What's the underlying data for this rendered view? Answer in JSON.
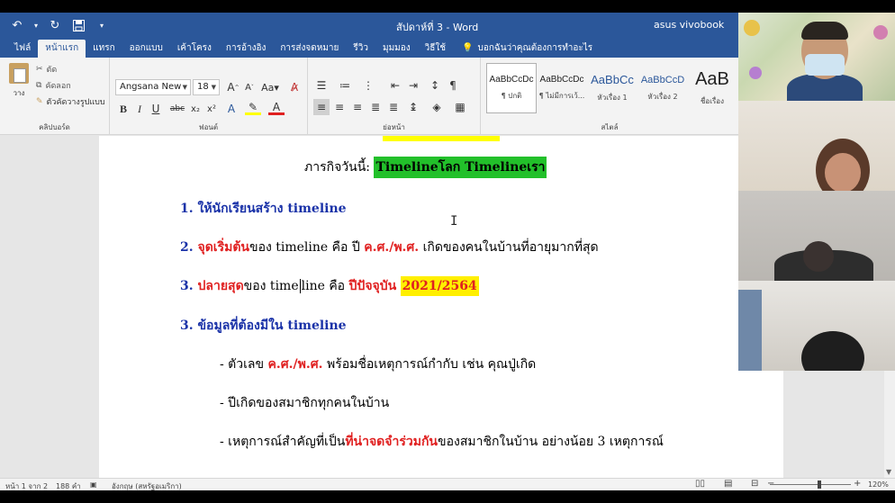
{
  "app": {
    "doc_title": "สัปดาห์ที่ 3  -  Word",
    "account": "asus vivobook"
  },
  "tabs": [
    "ไฟล์",
    "หน้าแรก",
    "แทรก",
    "ออกแบบ",
    "เค้าโครง",
    "การอ้างอิง",
    "การส่งจดหมาย",
    "รีวิว",
    "มุมมอง",
    "วิธีใช้"
  ],
  "active_tab": "หน้าแรก",
  "tell_me": "บอกฉันว่าคุณต้องการทำอะไร",
  "clipboard": {
    "paste": "วาง",
    "cut": "ตัด",
    "copy": "คัดลอก",
    "format_painter": "ตัวคัดวางรูปแบบ",
    "label": "คลิปบอร์ด"
  },
  "font": {
    "name": "Angsana New",
    "size": "18",
    "label": "ฟอนต์",
    "grow": "A",
    "aa": "Aa"
  },
  "paragraph": {
    "label": "ย่อหน้า"
  },
  "styles": {
    "label": "สไตล์",
    "items": [
      {
        "sample": "AaBbCcDc",
        "name": "¶ ปกติ"
      },
      {
        "sample": "AaBbCcDc",
        "name": "¶ ไม่มีการเว้..."
      },
      {
        "sample": "AaBbCc",
        "name": "หัวเรื่อง 1"
      },
      {
        "sample": "AaBbCcD",
        "name": "หัวเรื่อง 2"
      },
      {
        "sample": "AaB",
        "name": "ชื่อเรื่อง"
      }
    ]
  },
  "document": {
    "heading_prefix": "ภารกิจวันนี้: ",
    "heading_highlight": "Timelineโลก Timelineเรา",
    "item1": "1. ให้นักเรียนสร้าง timeline",
    "item2_num": "2. ",
    "item2_bold": "จุดเริ่มต้น",
    "item2_text": "ของ timeline คือ ปี ",
    "item2_red": "ค.ศ./พ.ศ.",
    "item2_tail": " เกิดของคนในบ้านที่อายุมากที่สุด",
    "item3_num": "3. ",
    "item3_bold": "ปลายสุด",
    "item3_text_a": "ของ time",
    "item3_text_b": "line คือ ",
    "item3_red": "ปีปัจจุบัน",
    "item3_year": "2021/2564",
    "item4": "3. ข้อมูลที่ต้องมีใน timeline",
    "bullet1_a": "- ตัวเลข ",
    "bullet1_red": "ค.ศ./พ.ศ.",
    "bullet1_b": " พร้อมชื่อเหตุการณ์กำกับ เช่น คุณปู่เกิด",
    "bullet2": "- ปีเกิดของสมาชิกทุกคนในบ้าน",
    "bullet3_a": "- เหตุการณ์สำคัญที่เป็น",
    "bullet3_red": "ที่น่าจดจำร่วมกัน",
    "bullet3_b": "ของสมาชิกในบ้าน อย่างน้อย 3 เหตุการณ์"
  },
  "status": {
    "page": "หน้า 1 จาก 2",
    "words": "188 คำ",
    "language": "อังกฤษ (สหรัฐอเมริกา)",
    "zoom": "120%"
  },
  "colors": {
    "word_blue": "#2b579a",
    "heading_highlight": "#22c02a",
    "year_highlight": "#ffef00",
    "red_text": "#e02020",
    "blue_text": "#1a32a8"
  }
}
